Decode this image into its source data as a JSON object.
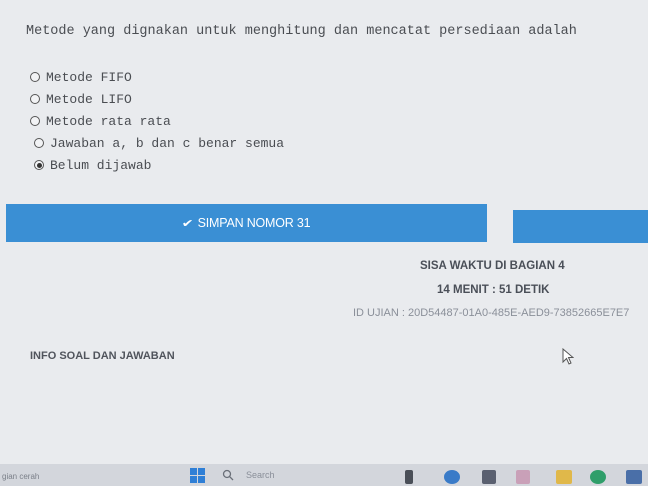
{
  "question": {
    "text": "Metode yang dignakan untuk menghitung dan mencatat persediaan adalah"
  },
  "options": [
    {
      "label": "Metode FIFO",
      "selected": false
    },
    {
      "label": "Metode LIFO",
      "selected": false
    },
    {
      "label": "Metode rata rata",
      "selected": false
    },
    {
      "label": "Jawaban a, b dan c benar semua",
      "selected": false
    },
    {
      "label": "Belum dijawab",
      "selected": true
    }
  ],
  "save_button": {
    "label": "SIMPAN NOMOR 31",
    "icon": "chevron-down-icon"
  },
  "timer": {
    "title": "SISA WAKTU DI BAGIAN 4",
    "value": "14 MENIT : 51 DETIK"
  },
  "exam_id": "ID UJIAN : 20D54487-01A0-485E-AED9-73852665E7E7",
  "info_section": {
    "title": "INFO SOAL DAN JAWABAN"
  },
  "taskbar": {
    "weather": "gian cerah",
    "search_placeholder": "Search"
  },
  "colors": {
    "accent": "#3a8fd4",
    "background": "#e9ebee"
  }
}
